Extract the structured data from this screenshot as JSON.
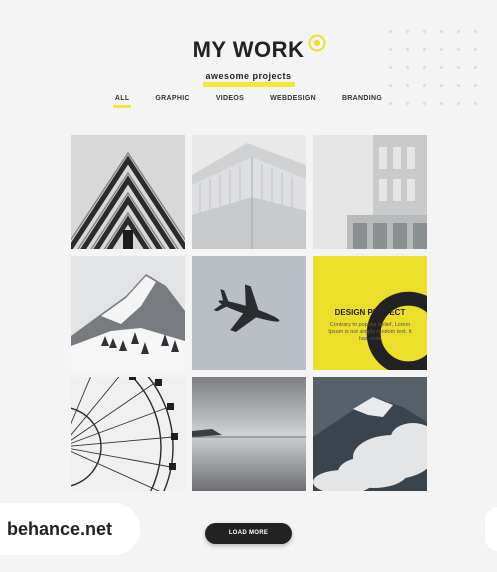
{
  "header": {
    "title": "MY WORK",
    "subtitle": "awesome projects"
  },
  "nav": {
    "items": [
      {
        "label": "ALL",
        "active": true
      },
      {
        "label": "GRAPHIC",
        "active": false
      },
      {
        "label": "VIDEOS",
        "active": false
      },
      {
        "label": "WEBDESIGN",
        "active": false
      },
      {
        "label": "BRANDING",
        "active": false
      }
    ]
  },
  "feature": {
    "icon": "search-icon",
    "title": "DESIGN PROJECT",
    "text": "Contrary to popular belief, Lorem Ipsum is not simply random text. It has roots"
  },
  "tiles": [
    {
      "name": "architecture-angles"
    },
    {
      "name": "white-building-blocks"
    },
    {
      "name": "concrete-building"
    },
    {
      "name": "snowy-mountain"
    },
    {
      "name": "airplane"
    },
    {
      "name": "design-project"
    },
    {
      "name": "ferris-wheel"
    },
    {
      "name": "calm-lake"
    },
    {
      "name": "misty-mountains"
    }
  ],
  "load_more": "LOAD MORE",
  "watermark": "behance.net",
  "colors": {
    "accent": "#ecdf2a",
    "dark": "#222222",
    "background": "#f4f4f4"
  }
}
